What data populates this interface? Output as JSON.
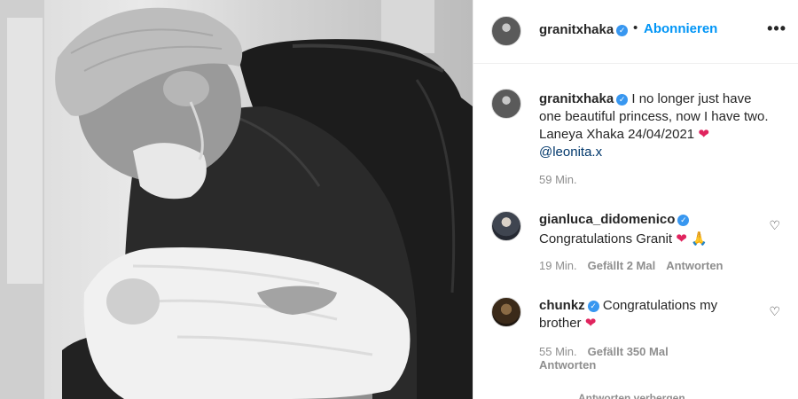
{
  "post": {
    "username": "granitxhaka",
    "follow_label": "Abonnieren",
    "more_label": "•••",
    "caption": {
      "line1": "I no longer just have",
      "line2": "one beautiful princess, now I have two.",
      "line3": "Laneya Xhaka 24/04/2021",
      "mention": "@leonita.x",
      "heart": "❤"
    },
    "timestamp": "59 Min."
  },
  "comments": [
    {
      "username": "gianluca_didomenico",
      "text": "Congratulations Granit",
      "emoji": "❤ 🙏",
      "time": "19 Min.",
      "likes": "Gefällt 2 Mal",
      "reply": "Antworten"
    },
    {
      "username": "chunkz",
      "text_line1": "Congratulations my",
      "text_line2": "brother",
      "emoji": "❤",
      "time": "55 Min.",
      "likes": "Gefällt 350 Mal",
      "reply": "Antworten"
    }
  ],
  "hide_replies": "Antworten verbergen",
  "icons": {
    "verified": "verified-badge-icon",
    "like": "heart-outline-icon",
    "more": "more-options-icon"
  },
  "colors": {
    "accent": "#0095f6",
    "verified": "#3897f0",
    "muted": "#8e8e8e",
    "heart": "#e0245e"
  }
}
